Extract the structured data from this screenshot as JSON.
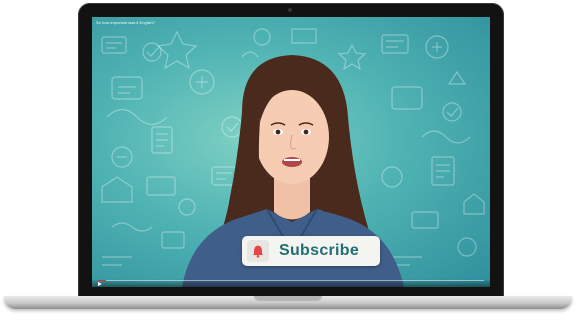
{
  "video": {
    "title": "So how important was it English?",
    "progress_fraction": 0.02
  },
  "overlay": {
    "subscribe_label": "Subscribe",
    "bell_icon": "bell-icon",
    "accent_color": "#e74646",
    "label_color": "#236e73"
  }
}
